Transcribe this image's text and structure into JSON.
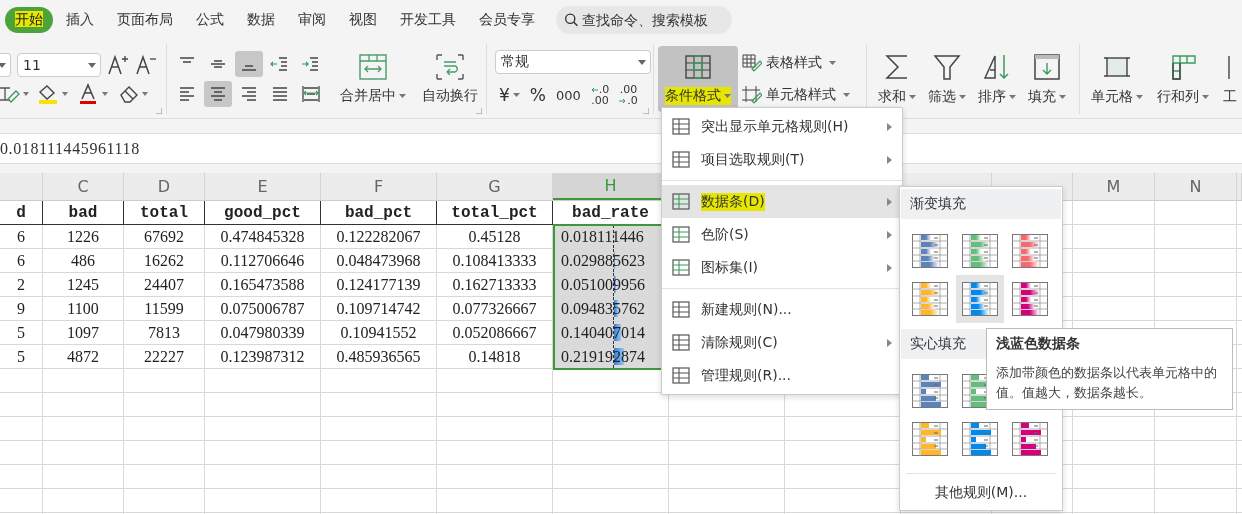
{
  "tabs": [
    {
      "label": "开始",
      "selected": true,
      "highlighted": true
    },
    {
      "label": "插入",
      "selected": false,
      "highlighted": false
    },
    {
      "label": "页面布局",
      "selected": false,
      "highlighted": false
    },
    {
      "label": "公式",
      "selected": false,
      "highlighted": false
    },
    {
      "label": "数据",
      "selected": false,
      "highlighted": false
    },
    {
      "label": "审阅",
      "selected": false,
      "highlighted": false
    },
    {
      "label": "视图",
      "selected": false,
      "highlighted": false
    },
    {
      "label": "开发工具",
      "selected": false,
      "highlighted": false
    },
    {
      "label": "会员专享",
      "selected": false,
      "highlighted": false
    }
  ],
  "search": {
    "placeholder": "查找命令、搜索模板"
  },
  "ribbon": {
    "font": {
      "size": "11"
    },
    "alignment": {
      "buttons": [
        {
          "selected": false
        },
        {
          "selected": false
        },
        {
          "selected": true
        },
        {
          "selected": false
        },
        {
          "selected": false
        },
        {
          "selected": false
        },
        {
          "selected": true
        },
        {
          "selected": false
        },
        {
          "selected": false
        },
        {
          "selected": false
        }
      ],
      "merge": "合并居中",
      "wrap": "自动换行"
    },
    "number": {
      "format": "常规",
      "currency": "¥",
      "percent": "%",
      "thousands": "000",
      "decimals": [
        {
          "top": ".0",
          "bottom": ".00"
        },
        {
          "top": ".00",
          "bottom": ".0"
        }
      ]
    },
    "styles": {
      "conditional": {
        "label": "条件格式",
        "selected": true,
        "highlighted": true
      },
      "table_style": "表格样式",
      "cell_style": "单元格样式"
    },
    "editing": [
      {
        "label": "求和"
      },
      {
        "label": "筛选"
      },
      {
        "label": "排序"
      },
      {
        "label": "填充"
      }
    ],
    "cells": [
      {
        "label": "单元格"
      },
      {
        "label": "行和列"
      },
      {
        "label": "工"
      }
    ]
  },
  "formula_bar": {
    "value": "0.018111445961118"
  },
  "sheet": {
    "columns": [
      {},
      {
        "letter": "C",
        "selected": false
      },
      {
        "letter": "D",
        "selected": false
      },
      {
        "letter": "E",
        "selected": false
      },
      {
        "letter": "F",
        "selected": false
      },
      {
        "letter": "G",
        "selected": false
      },
      {
        "letter": "H",
        "selected": true
      },
      {},
      {},
      {},
      {},
      {
        "letter": "M",
        "selected": false
      },
      {
        "letter": "N",
        "selected": false
      }
    ],
    "header_row": [
      "d",
      "bad",
      "total",
      "good_pct",
      "bad_pct",
      "total_pct",
      "bad_rate"
    ],
    "rows": [
      {
        "cells": [
          "6",
          "1226",
          "67692",
          "0.474845328",
          "0.122282067",
          "0.45128",
          "0.018111446"
        ]
      },
      {
        "cells": [
          "6",
          "486",
          "16262",
          "0.112706646",
          "0.048473968",
          "0.108413333",
          "0.029885623"
        ],
        "bar": {
          "level": 0.02
        }
      },
      {
        "cells": [
          "2",
          "1245",
          "24407",
          "0.165473588",
          "0.124177139",
          "0.162713333",
          "0.051009956"
        ],
        "bar": {
          "level": 0.04
        }
      },
      {
        "cells": [
          "9",
          "1100",
          "11599",
          "0.075006787",
          "0.109714742",
          "0.077326667",
          "0.094835762"
        ],
        "bar": {
          "level": 0.08
        }
      },
      {
        "cells": [
          "5",
          "1097",
          "7813",
          "0.047980339",
          "0.10941552",
          "0.052086667",
          "0.140407014"
        ],
        "bar": {
          "level": 0.13
        }
      },
      {
        "cells": [
          "5",
          "4872",
          "22227",
          "0.123987312",
          "0.485936565",
          "0.14818",
          "0.219192874"
        ],
        "bar": {
          "level": 0.17
        }
      }
    ]
  },
  "menu": {
    "sections": [
      [
        {
          "label": "突出显示单元格规则(H)",
          "submenu": true,
          "selected": false,
          "highlighted": false
        },
        {
          "label": "项目选取规则(T)",
          "submenu": true,
          "selected": false,
          "highlighted": false
        }
      ],
      [
        {
          "label": "数据条(D)",
          "submenu": true,
          "selected": true,
          "highlighted": true
        },
        {
          "label": "色阶(S)",
          "submenu": true,
          "selected": false,
          "highlighted": false
        },
        {
          "label": "图标集(I)",
          "submenu": true,
          "selected": false,
          "highlighted": false
        }
      ],
      [
        {
          "label": "新建规则(N)...",
          "submenu": false,
          "selected": false,
          "highlighted": false
        },
        {
          "label": "清除规则(C)",
          "submenu": true,
          "selected": false,
          "highlighted": false
        },
        {
          "label": "管理规则(R)...",
          "submenu": false,
          "selected": false,
          "highlighted": false
        }
      ]
    ]
  },
  "submenu": {
    "sections": [
      {
        "title": "渐变填充",
        "kind": "gradient",
        "swatches": [
          {
            "color": "#5b84bd",
            "selected": false
          },
          {
            "color": "#63be7b",
            "selected": false
          },
          {
            "color": "#f8696b",
            "selected": false
          },
          {
            "color": "#ffb628",
            "selected": false
          },
          {
            "color": "#008aef",
            "selected": true
          },
          {
            "color": "#d6007b",
            "selected": false
          }
        ]
      },
      {
        "title": "实心填充",
        "kind": "solid",
        "swatches": [
          {
            "color": "#5b84bd",
            "selected": false
          },
          {
            "color": "#63be7b",
            "selected": false
          },
          {
            "color": "#ffb628",
            "selected": false
          },
          {
            "color": "#008aef",
            "selected": false
          },
          {
            "color": "#d6007b",
            "selected": false
          }
        ]
      }
    ],
    "more": "其他规则(M)..."
  },
  "tooltip": {
    "title": "浅蓝色数据条",
    "text": "添加带颜色的数据条以代表单元格中的值。值越大，数据条越长。"
  }
}
